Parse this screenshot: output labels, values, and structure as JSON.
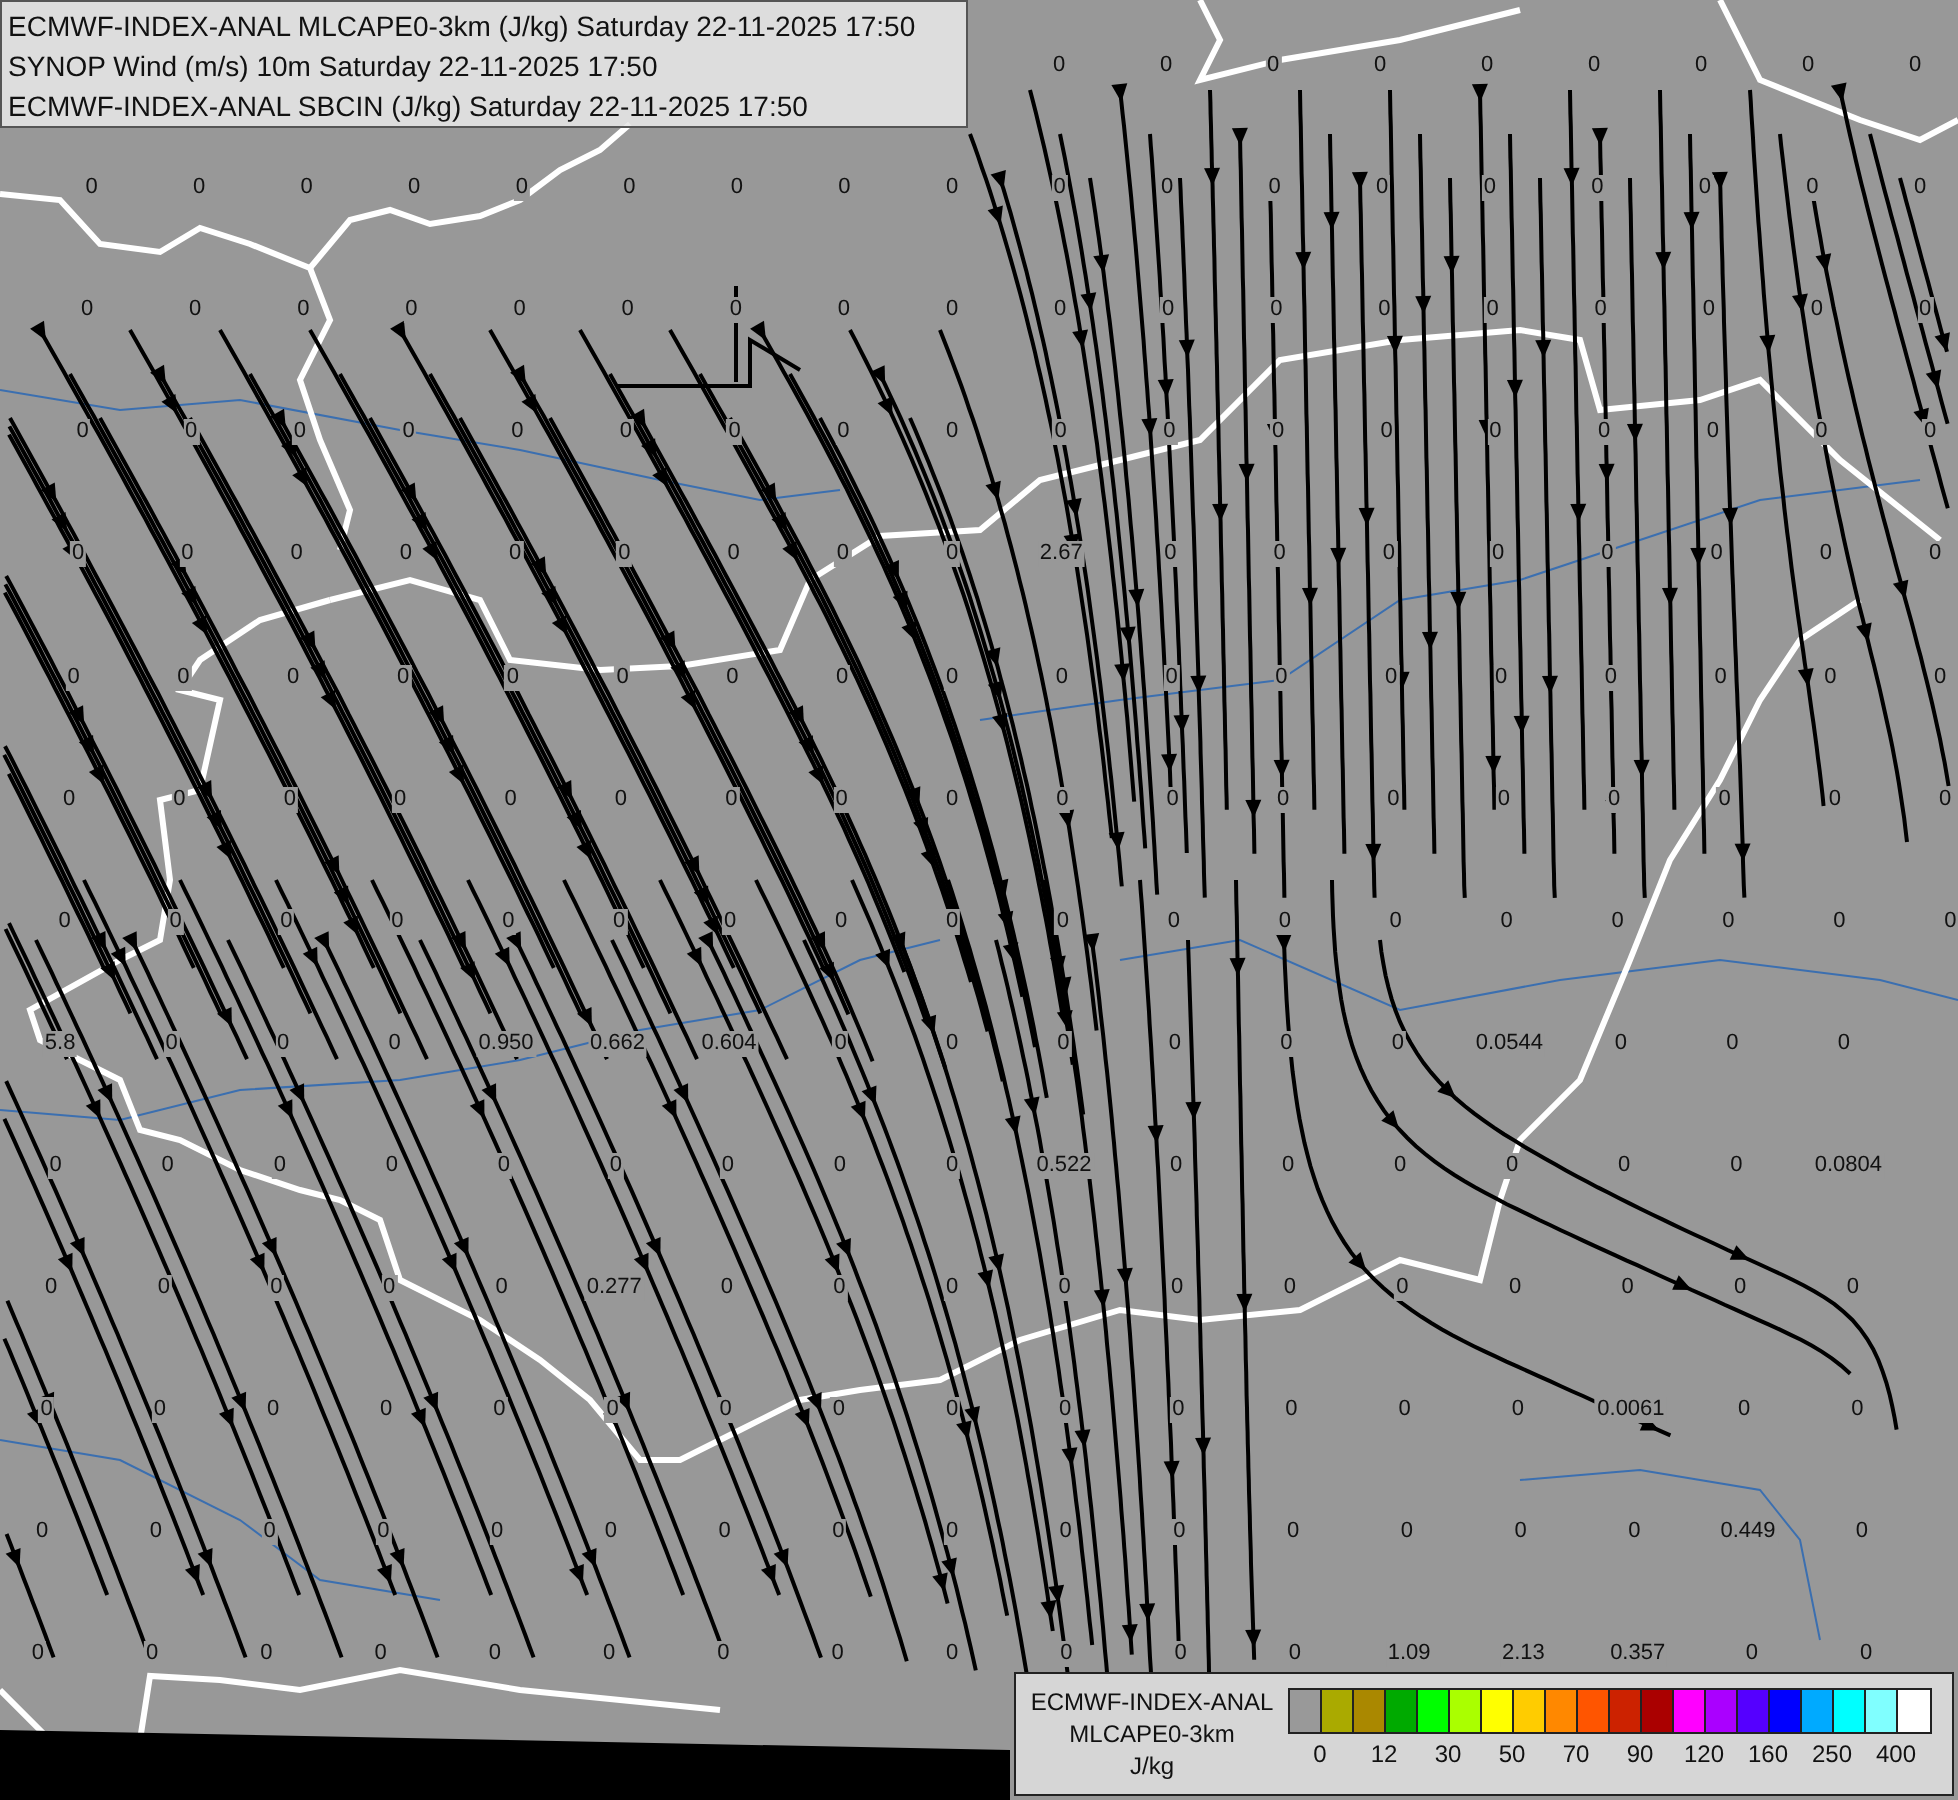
{
  "title_lines": [
    "ECMWF-INDEX-ANAL MLCAPE0-3km (J/kg) Saturday 22-11-2025 17:50",
    "SYNOP Wind (m/s) 10m Saturday 22-11-2025 17:50",
    "ECMWF-INDEX-ANAL SBCIN (J/kg) Saturday 22-11-2025 17:50"
  ],
  "station_rows": [
    [
      null,
      null,
      null,
      null,
      null,
      null,
      null,
      null,
      null,
      "0",
      "0",
      "0",
      "0",
      "0",
      "0",
      "0",
      "0",
      "0"
    ],
    [
      "0",
      "0",
      "0",
      "0",
      "0",
      "0",
      "0",
      "0",
      "0",
      "0",
      "0",
      "0",
      "0",
      "0",
      "0",
      "0",
      "0",
      "0"
    ],
    [
      "0",
      "0",
      "0",
      "0",
      "0",
      "0",
      "0",
      "0",
      "0",
      "0",
      "0",
      "0",
      "0",
      "0",
      "0",
      "0",
      "0",
      "0"
    ],
    [
      "0",
      "0",
      "0",
      "0",
      "0",
      "0",
      "0",
      "0",
      "0",
      "0",
      "0",
      "0",
      "0",
      "0",
      "0",
      "0",
      "0",
      "0"
    ],
    [
      "0",
      "0",
      "0",
      "0",
      "0",
      "0",
      "0",
      "0",
      "0",
      "2.67",
      "0",
      "0",
      "0",
      "0",
      "0",
      "0",
      "0",
      "0"
    ],
    [
      "0",
      "0",
      "0",
      "0",
      "0",
      "0",
      "0",
      "0",
      "0",
      "0",
      "0",
      "0",
      "0",
      "0",
      "0",
      "0",
      "0",
      "0"
    ],
    [
      "0",
      "0",
      "0",
      "0",
      "0",
      "0",
      "0",
      "0",
      "0",
      "0",
      "0",
      "0",
      "0",
      "0",
      "0",
      "0",
      "0",
      "0"
    ],
    [
      "0",
      "0",
      "0",
      "0",
      "0",
      "0",
      "0",
      "0",
      "0",
      "0",
      "0",
      "0",
      "0",
      "0",
      "0",
      "0",
      "0",
      "0"
    ],
    [
      "5.8",
      "0",
      "0",
      "0",
      "0.950",
      "0.662",
      "0.604",
      "0",
      "0",
      "0",
      "0",
      "0",
      "0",
      "0.0544",
      "0",
      "0",
      "0",
      null
    ],
    [
      "0",
      "0",
      "0",
      "0",
      "0",
      "0",
      "0",
      "0",
      "0",
      "0.522",
      "0",
      "0",
      "0",
      "0",
      "0",
      "0",
      "0.0804",
      null
    ],
    [
      "0",
      "0",
      "0",
      "0",
      "0",
      "0.277",
      "0",
      "0",
      "0",
      "0",
      "0",
      "0",
      "0",
      "0",
      "0",
      "0",
      "0",
      null
    ],
    [
      "0",
      "0",
      "0",
      "0",
      "0",
      "0",
      "0",
      "0",
      "0",
      "0",
      "0",
      "0",
      "0",
      "0",
      "0.0061",
      "0",
      "0",
      null
    ],
    [
      "0",
      "0",
      "0",
      "0",
      "0",
      "0",
      "0",
      "0",
      "0",
      "0",
      "0",
      "0",
      "0",
      "0",
      "0",
      "0.449",
      "0",
      null
    ],
    [
      "0",
      "0",
      "0",
      "0",
      "0",
      "0",
      "0",
      "0",
      "0",
      "0",
      "0",
      "0",
      "1.09",
      "2.13",
      "0.357",
      "0",
      "0",
      null
    ]
  ],
  "legend": {
    "lines": [
      "ECMWF-INDEX-ANAL",
      "MLCAPE0-3km",
      "J/kg"
    ],
    "swatches": [
      {
        "color": "#999999"
      },
      {
        "color": "#aaaa00"
      },
      {
        "color": "#aa8800"
      },
      {
        "color": "#00aa00"
      },
      {
        "color": "#00ff00"
      },
      {
        "color": "#aaff00"
      },
      {
        "color": "#ffff00"
      },
      {
        "color": "#ffcc00"
      },
      {
        "color": "#ff8800"
      },
      {
        "color": "#ff5500"
      },
      {
        "color": "#cc2200"
      },
      {
        "color": "#aa0000"
      },
      {
        "color": "#ff00ff"
      },
      {
        "color": "#aa00ff"
      },
      {
        "color": "#5500ff"
      },
      {
        "color": "#0000ff"
      },
      {
        "color": "#00aaff"
      },
      {
        "color": "#00ffff"
      },
      {
        "color": "#80ffff"
      },
      {
        "color": "#ffffff"
      }
    ],
    "ticks": [
      "0",
      "12",
      "30",
      "50",
      "70",
      "90",
      "120",
      "160",
      "250",
      "400"
    ]
  }
}
